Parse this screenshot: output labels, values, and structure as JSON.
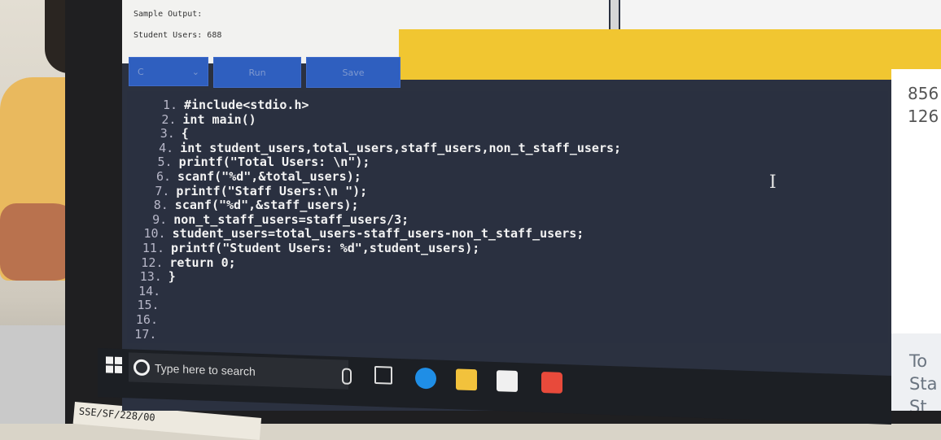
{
  "problem_pane": {
    "sample_output_label": "Sample Output:",
    "student_users_line": "Student Users: 688",
    "scroll_left": "<",
    "scroll_right": ">"
  },
  "toolbar": {
    "language_label": "C",
    "language_chevron": "⌄",
    "run_label": "Run",
    "save_label": "Save"
  },
  "editor": {
    "lines": [
      {
        "n": "1.",
        "code": "#include<stdio.h>"
      },
      {
        "n": "2.",
        "code": "int main()"
      },
      {
        "n": "3.",
        "code": "{"
      },
      {
        "n": "4.",
        "code": "int student_users,total_users,staff_users,non_t_staff_users;"
      },
      {
        "n": "5.",
        "code": "printf(\"Total Users: \\n\");"
      },
      {
        "n": "6.",
        "code": "scanf(\"%d\",&total_users);"
      },
      {
        "n": "7.",
        "code": "printf(\"Staff Users:\\n \");"
      },
      {
        "n": "8.",
        "code": "scanf(\"%d\",&staff_users);"
      },
      {
        "n": "9.",
        "code": "non_t_staff_users=staff_users/3;"
      },
      {
        "n": "10.",
        "code": "student_users=total_users-staff_users-non_t_staff_users;"
      },
      {
        "n": "11.",
        "code": "printf(\"Student Users: %d\",student_users);"
      },
      {
        "n": "12.",
        "code": "return 0;"
      },
      {
        "n": "13.",
        "code": "}"
      },
      {
        "n": "14.",
        "code": ""
      },
      {
        "n": "15.",
        "code": ""
      },
      {
        "n": "16.",
        "code": ""
      },
      {
        "n": "17.",
        "code": ""
      }
    ],
    "cursor_glyph": "I"
  },
  "output_pane": {
    "value1": "856",
    "value2": "126",
    "text1": "To",
    "text2": "Sta",
    "text3": "St"
  },
  "taskbar": {
    "search_placeholder": "Type here to search"
  },
  "sticker": {
    "text": "SSE/SF/228/00"
  },
  "colors": {
    "editor_bg": "#2a3040",
    "toolbar_button": "#2f5fbf",
    "accent_yellow": "#f1c631",
    "taskbar": "#1c1f24"
  }
}
